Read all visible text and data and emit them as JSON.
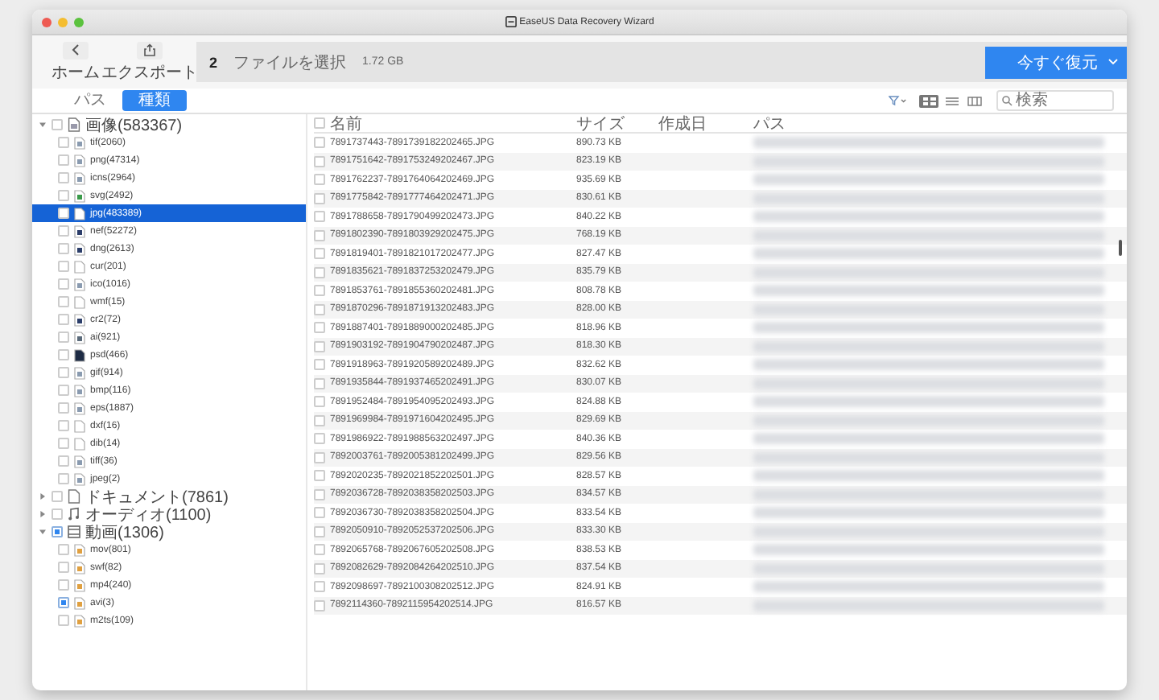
{
  "window": {
    "title": "EaseUS Data Recovery Wizard"
  },
  "toolbar": {
    "home": {
      "label": "ホーム"
    },
    "export": {
      "label": "エクスポート"
    },
    "count": "2",
    "count_label": "ファイルを選択",
    "size": "1.72 GB",
    "recover_button": "今すぐ復元"
  },
  "tabs": [
    {
      "label": "パス",
      "selected": false
    },
    {
      "label": "種類",
      "selected": true
    }
  ],
  "view_modes": [
    {
      "kind": "grid",
      "selected": true
    },
    {
      "kind": "list",
      "selected": false
    },
    {
      "kind": "columns",
      "selected": false
    }
  ],
  "search": {
    "placeholder": "検索"
  },
  "tree": [
    {
      "label": "画像(583367)",
      "kind": "image",
      "expanded": true,
      "checked": false,
      "selected": false,
      "children": [
        {
          "label": "tif(2060)",
          "kind": "image",
          "checked": false,
          "selected": false
        },
        {
          "label": "png(47314)",
          "kind": "image",
          "checked": false,
          "selected": false
        },
        {
          "label": "icns(2964)",
          "kind": "image",
          "checked": false,
          "selected": false
        },
        {
          "label": "svg(2492)",
          "kind": "vector",
          "checked": false,
          "selected": false
        },
        {
          "label": "jpg(483389)",
          "kind": "blank",
          "checked": false,
          "selected": true
        },
        {
          "label": "nef(52272)",
          "kind": "raw",
          "checked": false,
          "selected": false
        },
        {
          "label": "dng(2613)",
          "kind": "raw",
          "checked": false,
          "selected": false
        },
        {
          "label": "cur(201)",
          "kind": "blank",
          "checked": false,
          "selected": false
        },
        {
          "label": "ico(1016)",
          "kind": "image",
          "checked": false,
          "selected": false
        },
        {
          "label": "wmf(15)",
          "kind": "blank",
          "checked": false,
          "selected": false
        },
        {
          "label": "cr2(72)",
          "kind": "raw",
          "checked": false,
          "selected": false
        },
        {
          "label": "ai(921)",
          "kind": "ai",
          "checked": false,
          "selected": false
        },
        {
          "label": "psd(466)",
          "kind": "psd",
          "checked": false,
          "selected": false
        },
        {
          "label": "gif(914)",
          "kind": "image",
          "checked": false,
          "selected": false
        },
        {
          "label": "bmp(116)",
          "kind": "image",
          "checked": false,
          "selected": false
        },
        {
          "label": "eps(1887)",
          "kind": "image",
          "checked": false,
          "selected": false
        },
        {
          "label": "dxf(16)",
          "kind": "blank",
          "checked": false,
          "selected": false
        },
        {
          "label": "dib(14)",
          "kind": "blank",
          "checked": false,
          "selected": false
        },
        {
          "label": "tiff(36)",
          "kind": "image",
          "checked": false,
          "selected": false
        },
        {
          "label": "jpeg(2)",
          "kind": "image",
          "checked": false,
          "selected": false
        }
      ]
    },
    {
      "label": "ドキュメント(7861)",
      "kind": "document",
      "expanded": false,
      "checked": false,
      "selected": false
    },
    {
      "label": "オーディオ(1100)",
      "kind": "audio",
      "expanded": false,
      "checked": false,
      "selected": false
    },
    {
      "label": "動画(1306)",
      "kind": "video",
      "expanded": true,
      "checked": true,
      "selected": false,
      "children": [
        {
          "label": "mov(801)",
          "kind": "video",
          "checked": false,
          "selected": false
        },
        {
          "label": "swf(82)",
          "kind": "video",
          "checked": false,
          "selected": false
        },
        {
          "label": "mp4(240)",
          "kind": "video",
          "checked": false,
          "selected": false
        },
        {
          "label": "avi(3)",
          "kind": "video",
          "checked": true,
          "selected": false
        },
        {
          "label": "m2ts(109)",
          "kind": "video",
          "checked": false,
          "selected": false
        }
      ]
    }
  ],
  "table": {
    "select_all_checked": false,
    "columns": [
      "名前",
      "サイズ",
      "作成日",
      "パス"
    ],
    "rows": [
      {
        "name": "7891737443-7891739182202465.JPG",
        "size": "890.73 KB",
        "checked": false
      },
      {
        "name": "7891751642-7891753249202467.JPG",
        "size": "823.19 KB",
        "checked": false
      },
      {
        "name": "7891762237-7891764064202469.JPG",
        "size": "935.69 KB",
        "checked": false
      },
      {
        "name": "7891775842-7891777464202471.JPG",
        "size": "830.61 KB",
        "checked": false
      },
      {
        "name": "7891788658-7891790499202473.JPG",
        "size": "840.22 KB",
        "checked": false
      },
      {
        "name": "7891802390-7891803929202475.JPG",
        "size": "768.19 KB",
        "checked": false
      },
      {
        "name": "7891819401-7891821017202477.JPG",
        "size": "827.47 KB",
        "checked": false
      },
      {
        "name": "7891835621-7891837253202479.JPG",
        "size": "835.79 KB",
        "checked": false
      },
      {
        "name": "7891853761-7891855360202481.JPG",
        "size": "808.78 KB",
        "checked": false
      },
      {
        "name": "7891870296-7891871913202483.JPG",
        "size": "828.00 KB",
        "checked": false
      },
      {
        "name": "7891887401-7891889000202485.JPG",
        "size": "818.96 KB",
        "checked": false
      },
      {
        "name": "7891903192-7891904790202487.JPG",
        "size": "818.30 KB",
        "checked": false
      },
      {
        "name": "7891918963-7891920589202489.JPG",
        "size": "832.62 KB",
        "checked": false
      },
      {
        "name": "7891935844-7891937465202491.JPG",
        "size": "830.07 KB",
        "checked": false
      },
      {
        "name": "7891952484-7891954095202493.JPG",
        "size": "824.88 KB",
        "checked": false
      },
      {
        "name": "7891969984-7891971604202495.JPG",
        "size": "829.69 KB",
        "checked": false
      },
      {
        "name": "7891986922-7891988563202497.JPG",
        "size": "840.36 KB",
        "checked": false
      },
      {
        "name": "7892003761-7892005381202499.JPG",
        "size": "829.56 KB",
        "checked": false
      },
      {
        "name": "7892020235-7892021852202501.JPG",
        "size": "828.57 KB",
        "checked": false
      },
      {
        "name": "7892036728-7892038358202503.JPG",
        "size": "834.57 KB",
        "checked": false
      },
      {
        "name": "7892036730-7892038358202504.JPG",
        "size": "833.54 KB",
        "checked": false
      },
      {
        "name": "7892050910-7892052537202506.JPG",
        "size": "833.30 KB",
        "checked": false
      },
      {
        "name": "7892065768-7892067605202508.JPG",
        "size": "838.53 KB",
        "checked": false
      },
      {
        "name": "7892082629-7892084264202510.JPG",
        "size": "837.54 KB",
        "checked": false
      },
      {
        "name": "7892098697-7892100308202512.JPG",
        "size": "824.91 KB",
        "checked": false
      },
      {
        "name": "7892114360-7892115954202514.JPG",
        "size": "816.57 KB",
        "checked": false
      }
    ]
  }
}
